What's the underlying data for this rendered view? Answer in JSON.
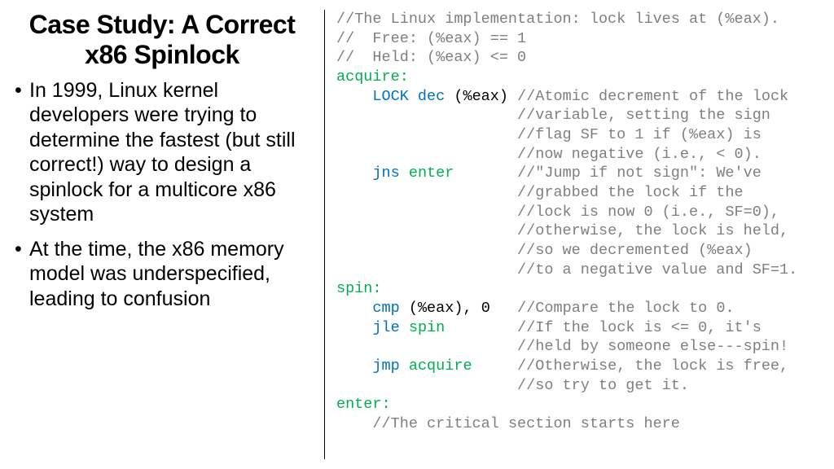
{
  "title": "Case Study: A Correct x86 Spinlock",
  "bullets": [
    "In 1999, Linux kernel developers were trying to determine the fastest (but still correct!) way to design a spinlock for a multicore x86 system",
    "At the time, the x86 memory model was underspecified, leading to confusion"
  ],
  "code": {
    "c0": "//The Linux implementation: lock lives at (%eax).",
    "c1": "//  Free: (%eax) == 1",
    "c2": "//  Held: (%eax) <= 0",
    "l_acquire": "acquire:",
    "i_lockdec_kw": "LOCK dec",
    "i_lockdec_op": "(%eax)",
    "c_lockdec1": "//Atomic decrement of the lock",
    "c_lockdec2": "//variable, setting the sign",
    "c_lockdec3": "//flag SF to 1 if (%eax) is",
    "c_lockdec4": "//now negative (i.e., < 0).",
    "i_jns_kw": "jns",
    "i_jns_tgt": "enter",
    "c_jns1": "//\"Jump if not sign\": We've",
    "c_jns2": "//grabbed the lock if the",
    "c_jns3": "//lock is now 0 (i.e., SF=0),",
    "c_jns4": "//otherwise, the lock is held,",
    "c_jns5": "//so we decremented (%eax)",
    "c_jns6": "//to a negative value and SF=1.",
    "l_spin": "spin:",
    "i_cmp_kw": "cmp",
    "i_cmp_op": "(%eax)",
    "i_cmp_comma": ",",
    "i_cmp_zero": "0",
    "c_cmp1": "//Compare the lock to 0.",
    "i_jle_kw": "jle",
    "i_jle_tgt": "spin",
    "c_jle1": "//If the lock is <= 0, it's",
    "c_jle2": "//held by someone else---spin!",
    "i_jmp_kw": "jmp",
    "i_jmp_tgt": "acquire",
    "c_jmp1": "//Otherwise, the lock is free,",
    "c_jmp2": "//so try to get it.",
    "l_enter": "enter:",
    "c_enter1": "//The critical section starts here"
  }
}
